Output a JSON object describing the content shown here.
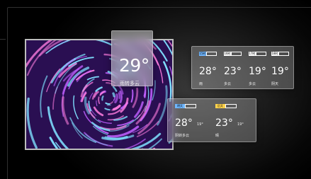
{
  "colors": {
    "background": "#000000",
    "badge_blue": "#6fb6ff",
    "badge_yellow": "#ffd34d",
    "badge_white": "#ffffff"
  },
  "current": {
    "temperature": "29°",
    "condition": "雨转多云"
  },
  "forecast": [
    {
      "badge": "15时",
      "badge_color": "#6fb6ff",
      "temperature": "28°",
      "condition": "雨"
    },
    {
      "badge": "16时",
      "badge_color": "#ffffff",
      "temperature": "23°",
      "condition": "多云"
    },
    {
      "badge": "17时",
      "badge_color": "#ffffff",
      "temperature": "19°",
      "condition": "多云"
    },
    {
      "badge": "18时",
      "badge_color": "#ffffff",
      "temperature": "19°",
      "condition": "阴天"
    }
  ],
  "daily": [
    {
      "badge": "明天",
      "badge_color": "#6fb6ff",
      "high": "28°",
      "low": "19°",
      "condition": "阴转多云"
    },
    {
      "badge": "后天",
      "badge_color": "#ffd34d",
      "high": "23°",
      "low": "19°",
      "condition": "晴"
    }
  ],
  "wallpaper": {
    "icon": "swirl-pattern",
    "palette": [
      "#7fe0ff",
      "#c060ff",
      "#ff7ee0",
      "#3a1a6a"
    ]
  }
}
